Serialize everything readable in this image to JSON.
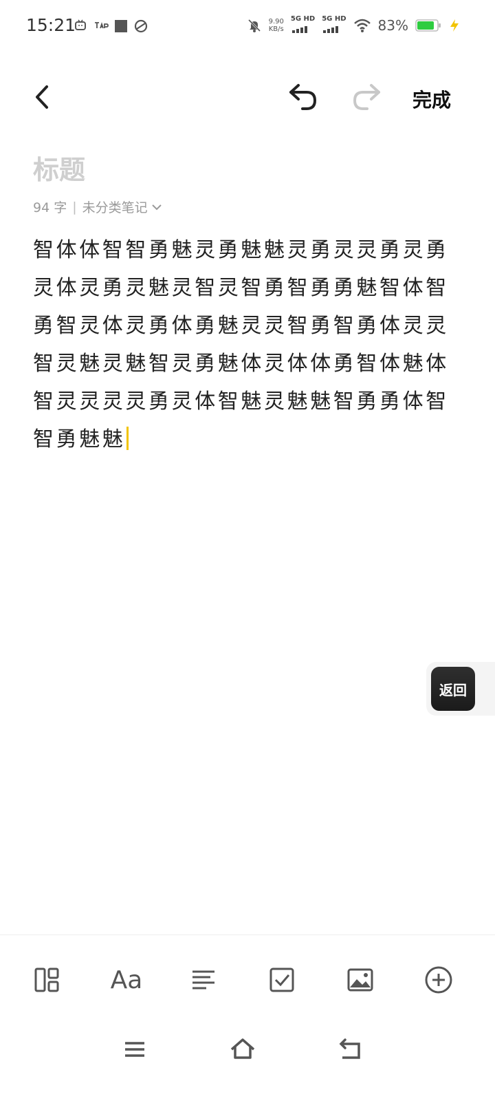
{
  "status_bar": {
    "time": "15:21",
    "speed_value": "9.90",
    "speed_unit": "KB/s",
    "sim1": "5G HD",
    "sim2": "5G HD",
    "battery": "83%",
    "left_icons": [
      "tv-icon",
      "tap-icon",
      "square-icon",
      "sync-icon"
    ],
    "right_icons": [
      "bell-off-icon",
      "signal-icon",
      "wifi-icon",
      "battery-icon",
      "charging-icon"
    ]
  },
  "header": {
    "done_label": "完成"
  },
  "note": {
    "title_placeholder": "标题",
    "word_count": "94 字",
    "category": "未分类笔记",
    "body": "智体体智智勇魅灵勇魅魅灵勇灵灵勇灵勇灵体灵勇灵魅灵智灵智勇智勇勇魅智体智勇智灵体灵勇体勇魅灵灵智勇智勇体灵灵智灵魅灵魅智灵勇魅体灵体体勇智体魅体智灵灵灵灵勇灵体智魅灵魅魅智勇勇体智智勇魅魅"
  },
  "floating": {
    "label": "返回"
  },
  "toolbar": {
    "items": [
      "layout-icon",
      "text-format-icon",
      "paragraph-align-icon",
      "checkbox-icon",
      "image-icon",
      "add-circle-icon"
    ],
    "aa_label": "Aa"
  },
  "colors": {
    "caret": "#f2c400",
    "battery": "#2ecc40",
    "placeholder": "#cfcfcf"
  }
}
